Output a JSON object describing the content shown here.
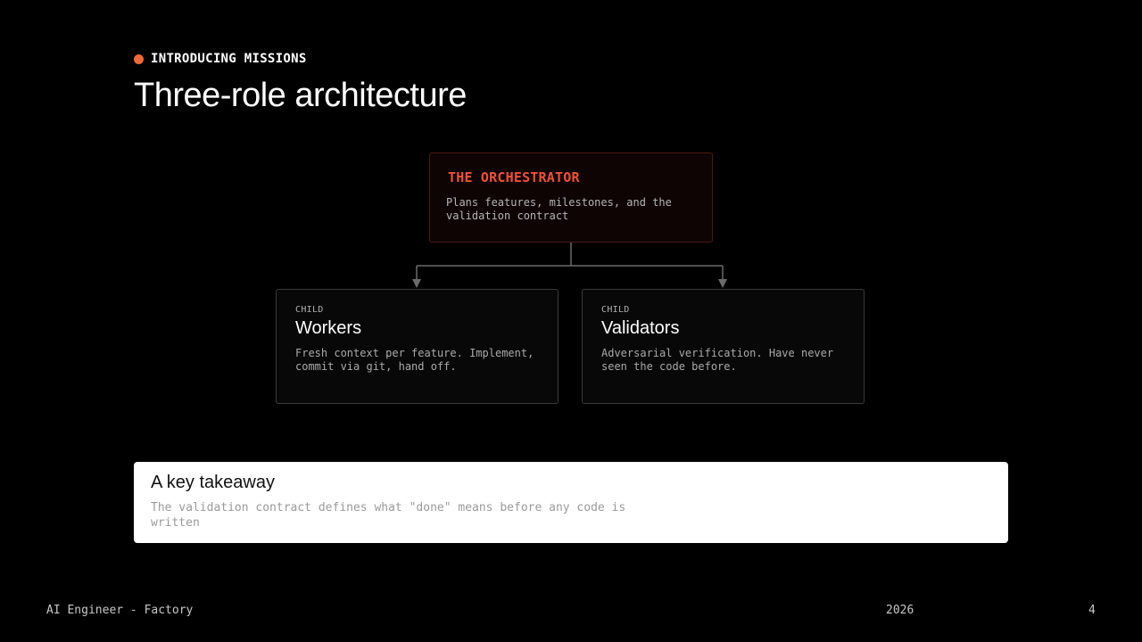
{
  "header": {
    "kicker": "INTRODUCING MISSIONS",
    "title": "Three-role architecture"
  },
  "diagram": {
    "orchestrator": {
      "title": "THE ORCHESTRATOR",
      "description": "Plans features, milestones, and the validation contract"
    },
    "children": [
      {
        "tag": "CHILD",
        "title": "Workers",
        "description": "Fresh context per feature. Implement, commit via git, hand off."
      },
      {
        "tag": "CHILD",
        "title": "Validators",
        "description": "Adversarial verification. Have never seen the code before."
      }
    ]
  },
  "takeaway": {
    "title": "A key takeaway",
    "description": "The validation contract defines what \"done\" means before any code is written"
  },
  "footer": {
    "left": "AI Engineer - Factory",
    "year": "2026",
    "page": "4"
  },
  "colors": {
    "accent": "#ef6a3a",
    "orchestrator_title": "#ef5138",
    "background": "#000000"
  }
}
